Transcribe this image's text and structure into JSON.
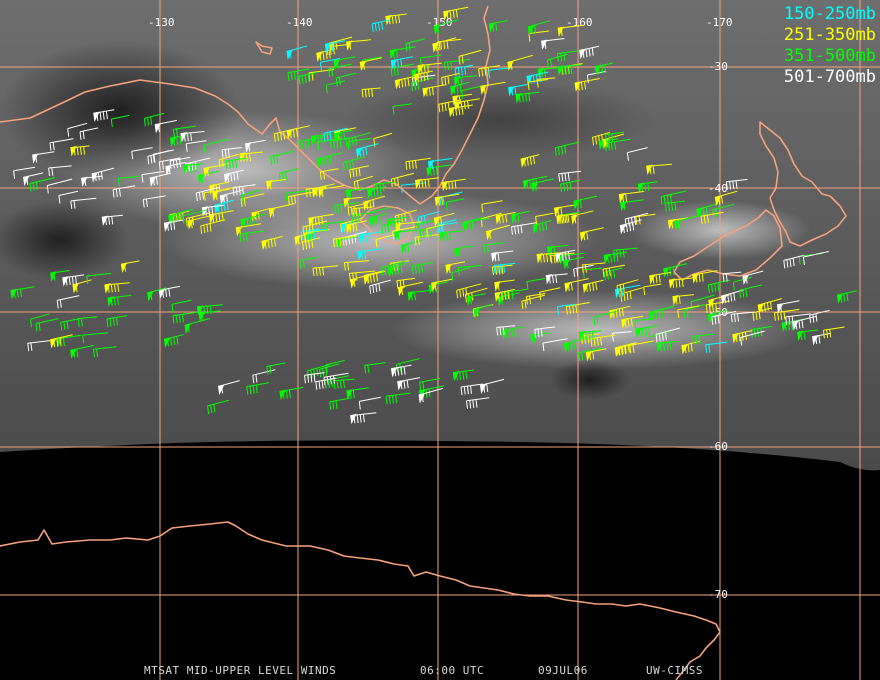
{
  "map": {
    "lon_labels": [
      "-130",
      "-140",
      "-150",
      "-160",
      "-170"
    ],
    "lat_labels": [
      "-30",
      "-40",
      "-50",
      "-60",
      "-70"
    ],
    "grid_color": "#f4a27e",
    "coast_color": "#f4a27e",
    "space_color": "#000000"
  },
  "legend": [
    {
      "label": "150-250mb",
      "color": "#00ffff"
    },
    {
      "label": "251-350mb",
      "color": "#ffff00"
    },
    {
      "label": "351-500mb",
      "color": "#00ff00"
    },
    {
      "label": "501-700mb",
      "color": "#ffffff"
    }
  ],
  "footer": {
    "product": "MTSAT MID-UPPER LEVEL WINDS",
    "time": "06:00 UTC",
    "date": "09JUL06",
    "source": "UW-CIMSS"
  }
}
